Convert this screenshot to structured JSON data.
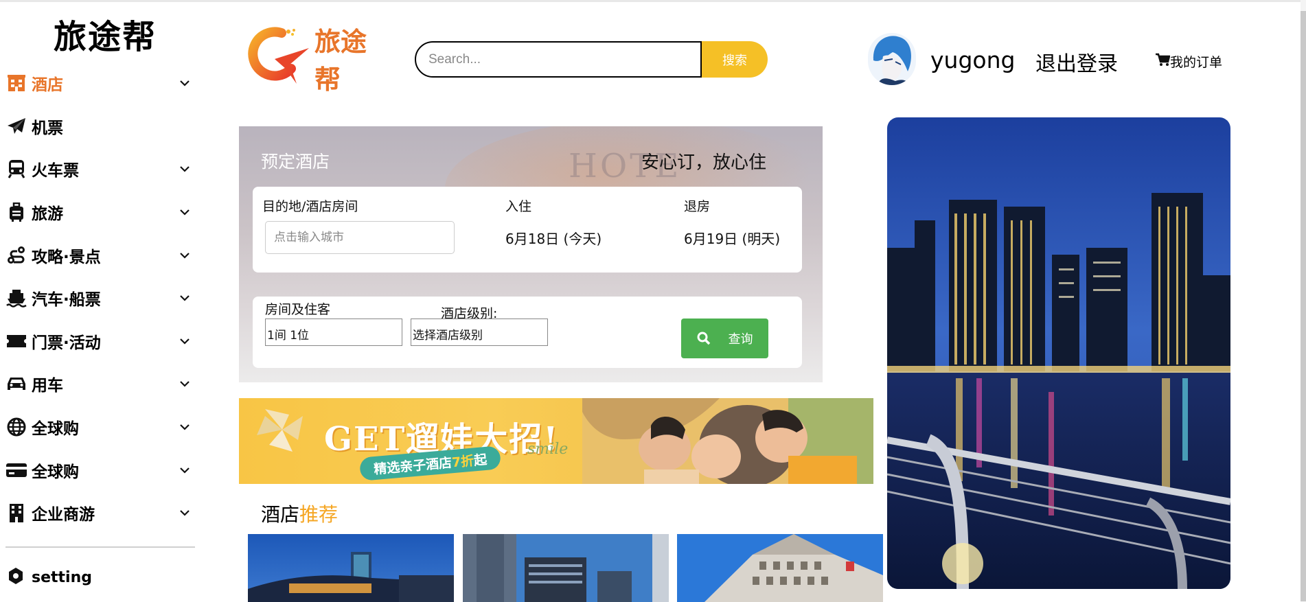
{
  "sidebar": {
    "brand": "旅途帮",
    "items": [
      {
        "label": "酒店",
        "icon": "hotel-icon",
        "active": true,
        "chevron": true
      },
      {
        "label": "机票",
        "icon": "paper-plane-icon",
        "active": false,
        "chevron": false
      },
      {
        "label": "火车票",
        "icon": "train-icon",
        "active": false,
        "chevron": true
      },
      {
        "label": "旅游",
        "icon": "suitcase-icon",
        "active": false,
        "chevron": true
      },
      {
        "label": "攻略·景点",
        "icon": "route-icon",
        "active": false,
        "chevron": true
      },
      {
        "label": "汽车·船票",
        "icon": "ship-icon",
        "active": false,
        "chevron": true
      },
      {
        "label": "门票·活动",
        "icon": "ticket-icon",
        "active": false,
        "chevron": true
      },
      {
        "label": "用车",
        "icon": "car-icon",
        "active": false,
        "chevron": true
      },
      {
        "label": "全球购",
        "icon": "globe-icon",
        "active": false,
        "chevron": true
      },
      {
        "label": "全球购",
        "icon": "credit-card-icon",
        "active": false,
        "chevron": true
      },
      {
        "label": "企业商游",
        "icon": "building-icon",
        "active": false,
        "chevron": true
      }
    ],
    "setting_label": "setting"
  },
  "header": {
    "logo_text": "旅途帮",
    "search_placeholder": "Search...",
    "search_button": "搜索",
    "username": "yugong",
    "logout": "退出登录",
    "orders": "我的订单"
  },
  "booking": {
    "title": "预定酒店",
    "slogan": "安心订，放心住",
    "destination_label": "目的地/酒店房间",
    "city_placeholder": "点击输入城市",
    "checkin_label": "入住",
    "checkin_date": "6月18日 (今天)",
    "checkout_label": "退房",
    "checkout_date": "6月19日 (明天)",
    "rooms_label": "房间及住客",
    "rooms_value": "1间 1位",
    "level_label": "酒店级别:",
    "level_value": "选择酒店级别",
    "query_button": "查询"
  },
  "banner": {
    "get_text": "GET遛娃大招!",
    "pill_text": "精选亲子酒店",
    "pill_discount": "7折",
    "pill_suffix": "起",
    "smile": "smile"
  },
  "recommend": {
    "title_part1": "酒店",
    "title_part2": "推荐"
  },
  "colors": {
    "accent": "#e8752a",
    "search_button": "#f5c026",
    "query_button": "#4cb050",
    "highlight": "#f5a623"
  }
}
